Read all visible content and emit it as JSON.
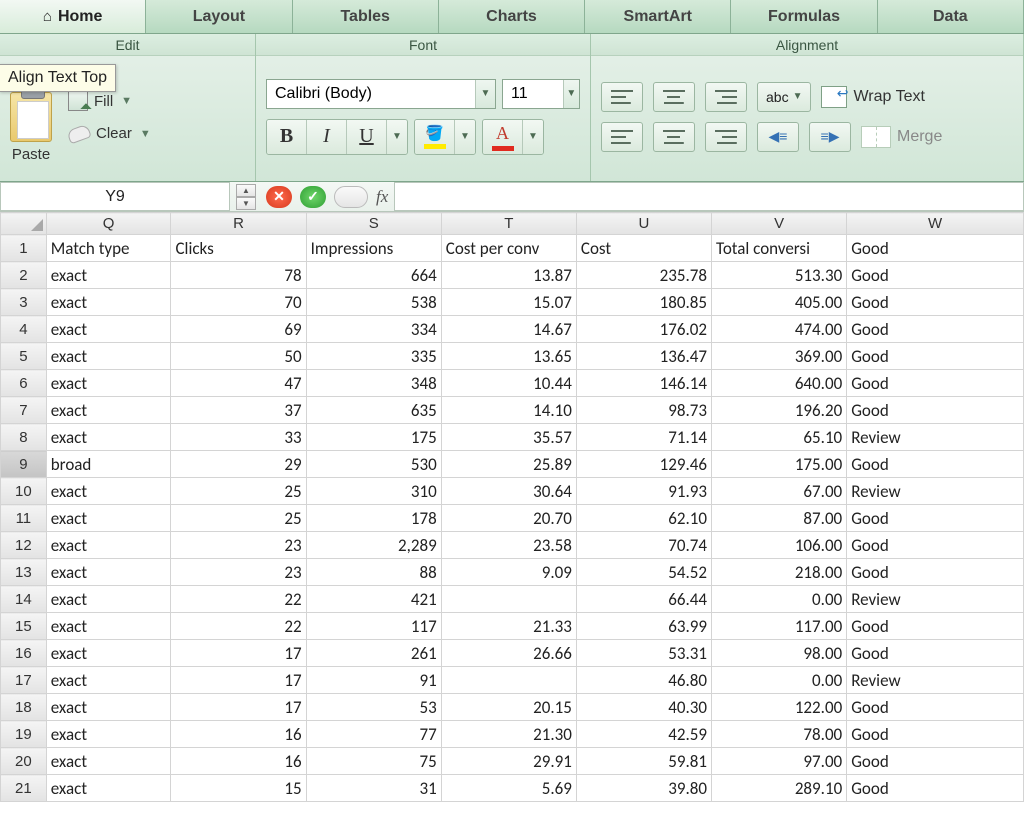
{
  "tabs": [
    "Home",
    "Layout",
    "Tables",
    "Charts",
    "SmartArt",
    "Formulas",
    "Data"
  ],
  "activeTab": "Home",
  "tooltip": "Align Text Top",
  "groups": {
    "edit": {
      "title": "Edit",
      "paste": "Paste",
      "fill": "Fill",
      "clear": "Clear"
    },
    "font": {
      "title": "Font",
      "name": "Calibri (Body)",
      "size": "11"
    },
    "alignment": {
      "title": "Alignment",
      "abc": "abc",
      "wrap": "Wrap Text",
      "merge": "Merge"
    }
  },
  "nameBox": "Y9",
  "fxLabel": "fx",
  "columns": [
    "Q",
    "R",
    "S",
    "T",
    "U",
    "V",
    "W"
  ],
  "selectedRow": 9,
  "headerRow": {
    "Q": "Match type",
    "R": "Clicks",
    "S": "Impressions",
    "T": "Cost per conv",
    "U": "Cost",
    "V": "Total conversi",
    "W": "Good"
  },
  "rows": [
    {
      "n": 2,
      "Q": "exact",
      "R": "78",
      "S": "664",
      "T": "13.87",
      "U": "235.78",
      "V": "513.30",
      "W": "Good"
    },
    {
      "n": 3,
      "Q": "exact",
      "R": "70",
      "S": "538",
      "T": "15.07",
      "U": "180.85",
      "V": "405.00",
      "W": "Good"
    },
    {
      "n": 4,
      "Q": "exact",
      "R": "69",
      "S": "334",
      "T": "14.67",
      "U": "176.02",
      "V": "474.00",
      "W": "Good"
    },
    {
      "n": 5,
      "Q": "exact",
      "R": "50",
      "S": "335",
      "T": "13.65",
      "U": "136.47",
      "V": "369.00",
      "W": "Good"
    },
    {
      "n": 6,
      "Q": "exact",
      "R": "47",
      "S": "348",
      "T": "10.44",
      "U": "146.14",
      "V": "640.00",
      "W": "Good"
    },
    {
      "n": 7,
      "Q": "exact",
      "R": "37",
      "S": "635",
      "T": "14.10",
      "U": "98.73",
      "V": "196.20",
      "W": "Good"
    },
    {
      "n": 8,
      "Q": "exact",
      "R": "33",
      "S": "175",
      "T": "35.57",
      "U": "71.14",
      "V": "65.10",
      "W": "Review"
    },
    {
      "n": 9,
      "Q": "broad",
      "R": "29",
      "S": "530",
      "T": "25.89",
      "U": "129.46",
      "V": "175.00",
      "W": "Good"
    },
    {
      "n": 10,
      "Q": "exact",
      "R": "25",
      "S": "310",
      "T": "30.64",
      "U": "91.93",
      "V": "67.00",
      "W": "Review"
    },
    {
      "n": 11,
      "Q": "exact",
      "R": "25",
      "S": "178",
      "T": "20.70",
      "U": "62.10",
      "V": "87.00",
      "W": "Good"
    },
    {
      "n": 12,
      "Q": "exact",
      "R": "23",
      "S": "2,289",
      "T": "23.58",
      "U": "70.74",
      "V": "106.00",
      "W": "Good"
    },
    {
      "n": 13,
      "Q": "exact",
      "R": "23",
      "S": "88",
      "T": "9.09",
      "U": "54.52",
      "V": "218.00",
      "W": "Good"
    },
    {
      "n": 14,
      "Q": "exact",
      "R": "22",
      "S": "421",
      "T": "",
      "U": "66.44",
      "V": "0.00",
      "W": "Review"
    },
    {
      "n": 15,
      "Q": "exact",
      "R": "22",
      "S": "117",
      "T": "21.33",
      "U": "63.99",
      "V": "117.00",
      "W": "Good"
    },
    {
      "n": 16,
      "Q": "exact",
      "R": "17",
      "S": "261",
      "T": "26.66",
      "U": "53.31",
      "V": "98.00",
      "W": "Good"
    },
    {
      "n": 17,
      "Q": "exact",
      "R": "17",
      "S": "91",
      "T": "",
      "U": "46.80",
      "V": "0.00",
      "W": "Review"
    },
    {
      "n": 18,
      "Q": "exact",
      "R": "17",
      "S": "53",
      "T": "20.15",
      "U": "40.30",
      "V": "122.00",
      "W": "Good"
    },
    {
      "n": 19,
      "Q": "exact",
      "R": "16",
      "S": "77",
      "T": "21.30",
      "U": "42.59",
      "V": "78.00",
      "W": "Good"
    },
    {
      "n": 20,
      "Q": "exact",
      "R": "16",
      "S": "75",
      "T": "29.91",
      "U": "59.81",
      "V": "97.00",
      "W": "Good"
    },
    {
      "n": 21,
      "Q": "exact",
      "R": "15",
      "S": "31",
      "T": "5.69",
      "U": "39.80",
      "V": "289.10",
      "W": "Good"
    }
  ]
}
